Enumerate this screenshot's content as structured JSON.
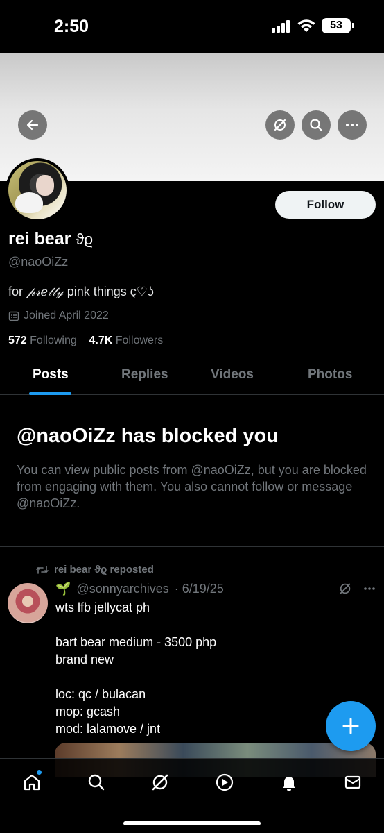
{
  "status_bar": {
    "time": "2:50",
    "battery": "53"
  },
  "profile": {
    "name": "rei bear ꒰ა",
    "name_suffix": "ϑϱ",
    "handle": "@naoOiZz",
    "bio": "for 𝓅𝓇𝑒𝓉𝓉𝓎 pink things ç♡ᘏ",
    "joined": "Joined April 2022",
    "following_count": "572",
    "following_label": "Following",
    "followers_count": "4.7K",
    "followers_label": "Followers",
    "follow_label": "Follow"
  },
  "tabs": [
    {
      "label": "Posts",
      "active": true
    },
    {
      "label": "Replies"
    },
    {
      "label": "Videos"
    },
    {
      "label": "Photos"
    }
  ],
  "blocked": {
    "title": "@naoOiZz has blocked you",
    "text": "You can view public posts from @naoOiZz, but you are blocked from engaging with them. You also cannot follow or message @naoOiZz."
  },
  "post": {
    "repost_label": "rei bear ϑϱ reposted",
    "author_handle": "@sonnyarchives",
    "date": "· 6/19/25",
    "text": "wts lfb jellycat ph\n\nbart bear medium - 3500 php\nbrand new\n\nloc: qc / bulacan\nmop: gcash\nmod: lalamove / jnt"
  },
  "colors": {
    "accent": "#1d9bf0",
    "muted": "#71767b",
    "bg": "#000000"
  }
}
